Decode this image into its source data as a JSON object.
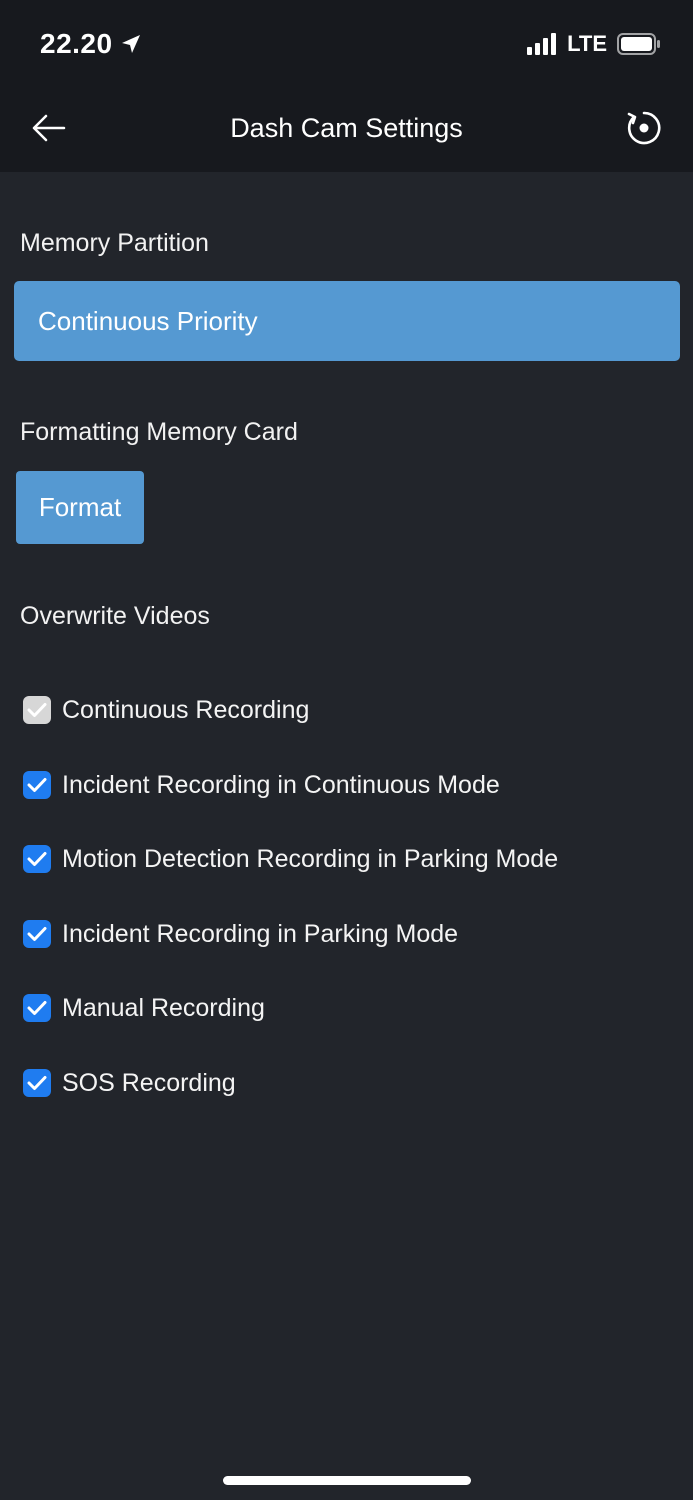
{
  "status_bar": {
    "time": "22.20",
    "network": "LTE"
  },
  "nav": {
    "title": "Dash Cam Settings"
  },
  "memory_partition": {
    "label": "Memory Partition",
    "value": "Continuous Priority"
  },
  "format_section": {
    "label": "Formatting Memory Card",
    "button": "Format"
  },
  "overwrite": {
    "label": "Overwrite Videos",
    "items": [
      {
        "label": "Continuous Recording",
        "checked": true,
        "disabled": true
      },
      {
        "label": "Incident Recording in Continuous Mode",
        "checked": true,
        "disabled": false
      },
      {
        "label": "Motion Detection Recording in Parking Mode",
        "checked": true,
        "disabled": false
      },
      {
        "label": "Incident Recording in Parking Mode",
        "checked": true,
        "disabled": false
      },
      {
        "label": "Manual Recording",
        "checked": true,
        "disabled": false
      },
      {
        "label": "SOS Recording",
        "checked": true,
        "disabled": false
      }
    ]
  },
  "colors": {
    "accent": "#5599d2",
    "checkbox": "#1f7cf0",
    "background": "#22252b",
    "header": "#17191e"
  }
}
